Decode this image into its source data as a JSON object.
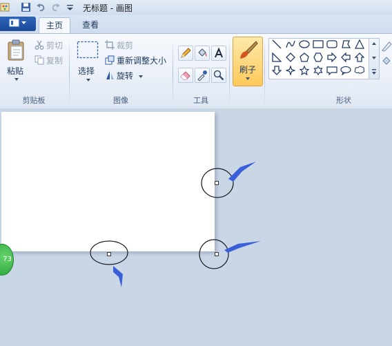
{
  "window": {
    "title": "无标题 - 画图"
  },
  "tabs": {
    "home": "主页",
    "view": "查看"
  },
  "clipboard": {
    "paste": "粘贴",
    "cut": "剪切",
    "copy": "复制",
    "group": "剪贴板"
  },
  "image": {
    "select": "选择",
    "crop": "裁剪",
    "resize": "重新调整大小",
    "rotate": "旋转",
    "group": "图像"
  },
  "tools": {
    "group": "工具"
  },
  "brushes": {
    "label": "刷子"
  },
  "shapes": {
    "group": "形状"
  },
  "status": {
    "badge_text": "73"
  }
}
